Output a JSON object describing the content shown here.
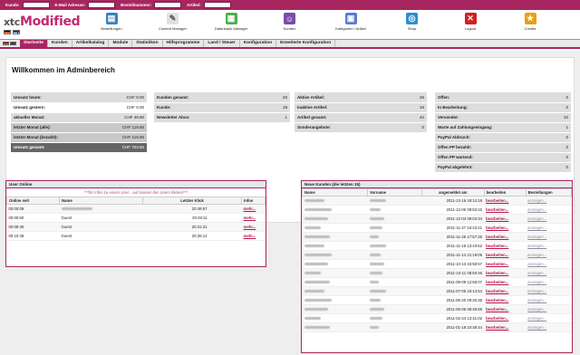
{
  "searchbar": {
    "fields": [
      "Kunde:",
      "E-Mail Adresse:",
      "Bestellnummer:",
      "Artikel:"
    ]
  },
  "logo": {
    "prefix": "xtc",
    "name": "Modified"
  },
  "toolbar": [
    {
      "label": "Bestellungen",
      "icon": "orders-icon",
      "color": "#3a7fc0"
    },
    {
      "label": "Content Manager",
      "icon": "document-icon",
      "color": "#e0e0e0"
    },
    {
      "label": "Datenbank Manager",
      "icon": "database-icon",
      "color": "#4caf50"
    },
    {
      "label": "Kunden",
      "icon": "users-icon",
      "color": "#7a4ca8"
    },
    {
      "label": "Kategorien / Artikel",
      "icon": "categories-icon",
      "color": "#5a7ad0"
    },
    {
      "label": "Shop",
      "icon": "globe-icon",
      "color": "#2c8fd0"
    },
    {
      "label": "Logout",
      "icon": "logout-icon",
      "color": "#d32020"
    },
    {
      "label": "Credits",
      "icon": "star-icon",
      "color": "#e8a010"
    }
  ],
  "nav": [
    "Startseite",
    "Kunden",
    "Artikelkatalog",
    "Module",
    "Statistiken",
    "Hilfsprogramme",
    "Land / Steuer",
    "Konfiguration",
    "Erweiterte Konfiguration"
  ],
  "welcome": "Willkommen im Adminbereich",
  "stats": {
    "revenue": [
      {
        "label": "Umsatz heute:",
        "value": "CHF 0.00"
      },
      {
        "label": "Umsatz gestern:",
        "value": "CHF 0.00"
      },
      {
        "label": "aktueller Monat:",
        "value": "CHF 49.90"
      },
      {
        "label": "letzter Monat (alle):",
        "value": "CHF 119.85"
      },
      {
        "label": "letzter Monat (bezahlt):",
        "value": "CHF 119.85"
      },
      {
        "label": "Umsatz gesamt:",
        "value": "CHF 703.60"
      }
    ],
    "customers": [
      {
        "label": "Kunden gesamt:",
        "value": "20"
      },
      {
        "label": "Kunde:",
        "value": "19"
      },
      {
        "label": "Newsletter Abos:",
        "value": "1"
      }
    ],
    "articles": [
      {
        "label": "Aktive Artikel:",
        "value": "26"
      },
      {
        "label": "Inaktive Artikel:",
        "value": "16"
      },
      {
        "label": "Artikel gesamt:",
        "value": "42"
      },
      {
        "label": "Sonderangebote:",
        "value": "0"
      }
    ],
    "orders": [
      {
        "label": "Offen:",
        "value": "0"
      },
      {
        "label": "In Bearbeitung:",
        "value": "0"
      },
      {
        "label": "Versendet:",
        "value": "10"
      },
      {
        "label": "Warte auf Zahlungseingang:",
        "value": "1"
      },
      {
        "label": "PayPal Abbruch:",
        "value": "0"
      },
      {
        "label": "Offen PP bezahlt:",
        "value": "0"
      },
      {
        "label": "Offen PP wartend:",
        "value": "0"
      },
      {
        "label": "PayPal abgelehnt:",
        "value": "0"
      }
    ]
  },
  "users_online": {
    "title": "User Online",
    "hint": "***für Infos zu einem User - auf Namen des Users klicken***",
    "headers": [
      "Online seit",
      "Name",
      "Letzter Klick",
      "Infos"
    ],
    "rows": [
      {
        "since": "00:00:09",
        "name": "",
        "last": "20:49:57",
        "info": "mehr..."
      },
      {
        "since": "00:00:50",
        "name": "Guest",
        "last": "20:49:11",
        "info": "mehr..."
      },
      {
        "since": "00:08:35",
        "name": "Guest",
        "last": "20:41:31",
        "info": "mehr..."
      },
      {
        "since": "00:10:49",
        "name": "Guest",
        "last": "20:39:12",
        "info": "mehr..."
      }
    ]
  },
  "new_customers": {
    "title": "Neue Kunden (die letzten 15)",
    "headers": [
      "Name",
      "Vorname",
      "angemeldet am",
      "bearbeiten",
      "Bestellungen"
    ],
    "edit": "bearbeiten...",
    "orders": "anzeigen...",
    "dates": [
      "2011-12-16 18:14:18",
      "2011-12-05 09:53:15",
      "2011-12-04 09:03:34",
      "2011-11-27 16:43:41",
      "2011-11-26 17:57:25",
      "2011-11-15 13:43:52",
      "2011-11-14 21:19:05",
      "2011-10-13 15:58:57",
      "2011-10-11 08:50:46",
      "2011-09-09 12:58:07",
      "2011-07-06 15:14:54",
      "2011-06-20 09:26:35",
      "2011-06-06 08:45:56",
      "2011-02-24 13:41:02",
      "2011-01-18 10:48:44"
    ]
  }
}
